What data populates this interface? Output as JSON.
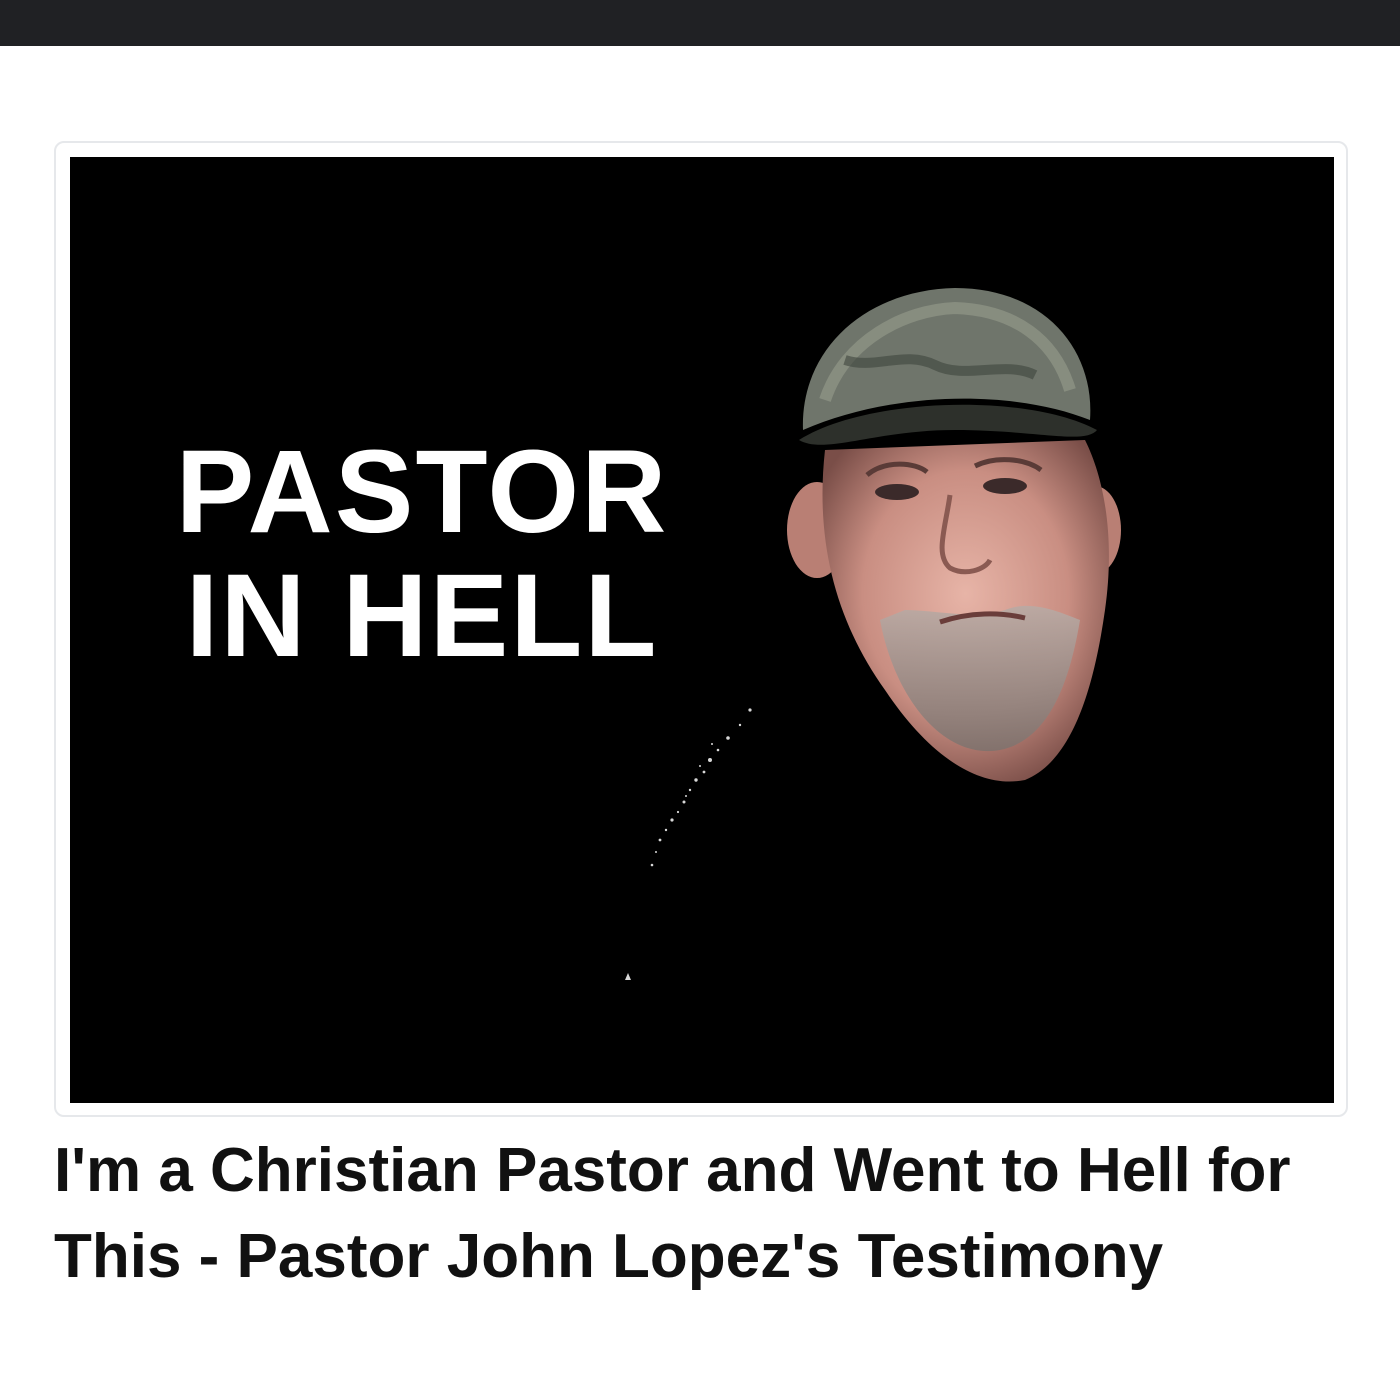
{
  "thumbnail": {
    "overlay_line1": "PASTOR",
    "overlay_line2": "IN HELL",
    "background_color": "#000000",
    "overlay_text_color": "#ffffff"
  },
  "video": {
    "title": "I'm a Christian Pastor and Went to Hell for This - Pastor John Lopez's Testimony"
  },
  "colors": {
    "top_bar": "#202124",
    "page_background": "#ffffff",
    "title_text": "#111111",
    "card_border": "#e6e8eb"
  }
}
